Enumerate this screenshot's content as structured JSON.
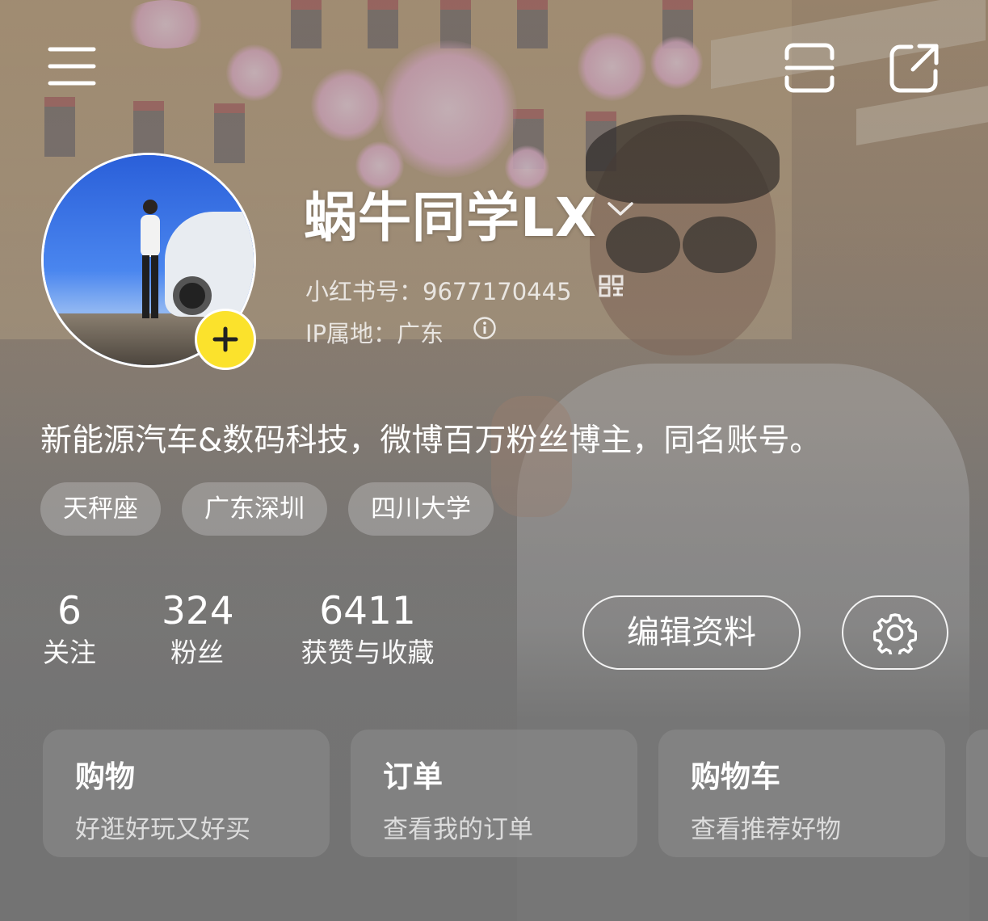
{
  "header": {
    "menu_icon": "menu-icon",
    "scan_icon": "scan-icon",
    "share_icon": "share-icon"
  },
  "profile": {
    "nickname": "蜗牛同学LX",
    "id_label": "小红书号：",
    "id_value": "9677170445",
    "ip_label": "IP属地：",
    "ip_value": "广东",
    "bio": "新能源汽车&数码科技，微博百万粉丝博主，同名账号。",
    "accent_color": "#fbe22c"
  },
  "tags": [
    "天秤座",
    "广东深圳",
    "四川大学"
  ],
  "stats": [
    {
      "value": "6",
      "label": "关注"
    },
    {
      "value": "324",
      "label": "粉丝"
    },
    {
      "value": "6411",
      "label": "获赞与收藏"
    }
  ],
  "actions": {
    "edit_label": "编辑资料",
    "settings_icon": "gear-icon"
  },
  "cards": [
    {
      "title": "购物",
      "subtitle": "好逛好玩又好买"
    },
    {
      "title": "订单",
      "subtitle": "查看我的订单"
    },
    {
      "title": "购物车",
      "subtitle": "查看推荐好物"
    }
  ]
}
